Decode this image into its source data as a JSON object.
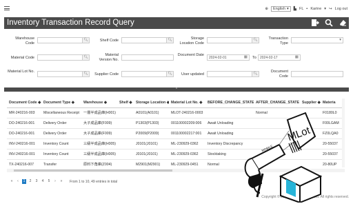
{
  "header": {
    "language": "English",
    "user_initials": "FL",
    "user_name": "Karine",
    "logout": "Log out"
  },
  "page": {
    "title": "Inventory Transaction Record Query"
  },
  "form": {
    "warehouse_code": "Warehouse Code",
    "shelf_code": "Shelf Code",
    "storage_location_code": "Storage Location Code",
    "transaction_type": "Transaction Type",
    "material_code": "Material Code",
    "material_version_no": "Material Version No.",
    "document_date": "Document Date",
    "date_from": "2024-02-01",
    "date_to_label": "To",
    "date_to": "2024-02-17",
    "material_lot_no": "Material Lot No.",
    "supplier_code": "Supplier Code",
    "user_updated": "User updated",
    "document_code": "Document Code"
  },
  "table": {
    "columns": [
      "Document Code ◆",
      "Document Type ◆",
      "Warehouse ◆",
      "Shelf ◆",
      "Storage Location ◆",
      "Material Lot No. ◆",
      "BEFORE_CHANGE_STATE ◆",
      "AFTER_CHANGE_STATE ◆",
      "Supplier ◆",
      "Materia"
    ],
    "rows": [
      [
        "MR-240216-003",
        "Miscellaneous Receipt",
        "一層半成品庫(H001)",
        "",
        "A0101(A0101)",
        "MLOT-240216-0003",
        "",
        "Normal",
        "",
        "F0180L0"
      ],
      [
        "DO-240216-001",
        "Delivery Order",
        "大子成品庫(F009)",
        "",
        "P1303(P1303)",
        "001100002209:006",
        "Await Unloading",
        "",
        "",
        "F00LGAM"
      ],
      [
        "DO-240216-001",
        "Delivery Order",
        "大子成品庫(F009)",
        "",
        "P2009(P2009)",
        "001100002217:001",
        "Await Unloading",
        "",
        "",
        "FZ0LQA0"
      ],
      [
        "INV-240216-001",
        "Inventory Count",
        "三級半成品庫(H005)",
        "",
        "J0101(J0101)",
        "ML-230929-0362",
        "Inventory Discrepancy",
        "",
        "",
        "20-55037"
      ],
      [
        "INV-240216-001",
        "Inventory Count",
        "三級半成品庫(H005)",
        "",
        "J0101(J0101)",
        "ML-230929-0362",
        "Stocktaking",
        "",
        "",
        "20-55037"
      ],
      [
        "TX-240216-007",
        "Transfer",
        "原料下角庫(Z004)",
        "",
        "M2901(M2901)",
        "ML-230929-0451",
        "Normal",
        "",
        "",
        "20-80UP"
      ]
    ]
  },
  "pager": {
    "first": "«",
    "prev": "‹",
    "pages": [
      "1",
      "2",
      "3",
      "4",
      "5"
    ],
    "next": "›",
    "last": "»",
    "info": "From 1 to 10, 49 entries in total"
  },
  "footer": {
    "copyright": "Copyright © 2020 NYT DATA Co., Ltd. All rights reserved."
  },
  "overlay": {
    "tag_text": "MLot",
    "gun_label": "MOBILE"
  },
  "colors": {
    "titlebar": "#4a4a4a",
    "accent": "#1e7bc4",
    "box_cyan": "#27b4d8"
  }
}
